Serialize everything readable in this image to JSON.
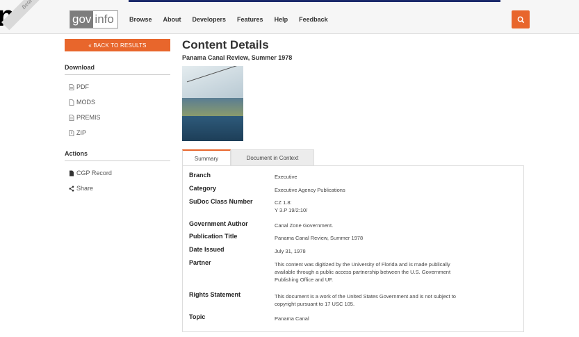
{
  "edge_glyph": "n",
  "beta_ribbon": "Beta Release",
  "logo": {
    "gov": "gov",
    "info": "info"
  },
  "nav": {
    "items": [
      "Browse",
      "About",
      "Developers",
      "Features",
      "Help",
      "Feedback"
    ]
  },
  "icons": {
    "search": "search-icon",
    "pdf": "pdf-icon",
    "mods": "file-icon",
    "premis": "file-icon",
    "zip": "zip-icon",
    "cgp": "document-icon",
    "share": "share-icon"
  },
  "colors": {
    "accent": "#e8662c",
    "nav_line": "#1b2a6b"
  },
  "sidebar": {
    "back_label": "« BACK TO RESULTS",
    "download_heading": "Download",
    "download_items": [
      "PDF",
      "MODS",
      "PREMIS",
      "ZIP"
    ],
    "actions_heading": "Actions",
    "action_items": [
      "CGP Record",
      "Share"
    ]
  },
  "main": {
    "title": "Content Details",
    "subtitle": "Panama Canal Review, Summer 1978",
    "tabs": [
      "Summary",
      "Document in Context"
    ],
    "details": [
      {
        "key": "Branch",
        "value": [
          "Executive"
        ]
      },
      {
        "key": "Category",
        "value": [
          "Executive Agency Publications"
        ]
      },
      {
        "key": "SuDoc Class Number",
        "value": [
          "CZ 1.8:",
          "Y 3.P 19/2:10/"
        ]
      },
      {
        "key": "Government Author",
        "value": [
          "Canal Zone Government."
        ]
      },
      {
        "key": "Publication Title",
        "value": [
          "Panama Canal Review, Summer 1978"
        ]
      },
      {
        "key": "Date Issued",
        "value": [
          "July 31, 1978"
        ]
      },
      {
        "key": "Partner",
        "value": [
          "This content was digitized by the University of Florida and is made publically",
          "available through a public access partnership between the U.S. Government",
          "Publishing Office and UF."
        ]
      },
      {
        "key": "Rights Statement",
        "value": [
          "This document is a work of the United States Government and is not subject to",
          "copyright pursuant to 17 USC 105."
        ]
      },
      {
        "key": "Topic",
        "value": [
          "Panama Canal"
        ]
      }
    ]
  }
}
